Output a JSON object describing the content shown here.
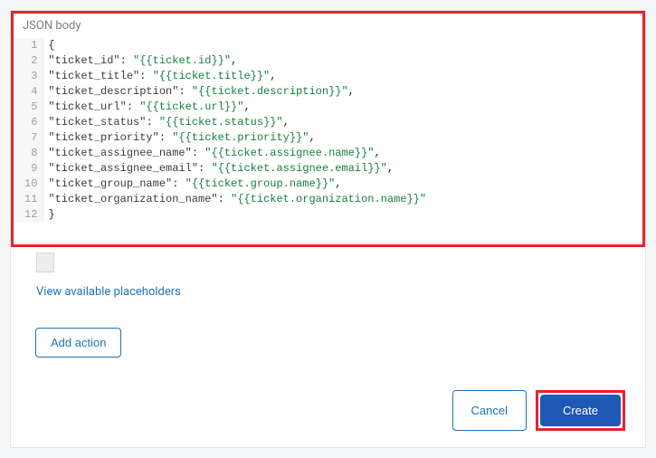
{
  "section": {
    "label": "JSON body"
  },
  "links": {
    "placeholders": "View available placeholders"
  },
  "actions": {
    "add": "Add action",
    "cancel": "Cancel",
    "create": "Create"
  },
  "code": {
    "lines": [
      "{",
      "\"ticket_id\": \"{{ticket.id}}\",",
      "\"ticket_title\": \"{{ticket.title}}\",",
      "\"ticket_description\": \"{{ticket.description}}\",",
      "\"ticket_url\": \"{{ticket.url}}\",",
      "\"ticket_status\": \"{{ticket.status}}\",",
      "\"ticket_priority\": \"{{ticket.priority}}\",",
      "\"ticket_assignee_name\": \"{{ticket.assignee.name}}\",",
      "\"ticket_assignee_email\": \"{{ticket.assignee.email}}\",",
      "\"ticket_group_name\": \"{{ticket.group.name}}\",",
      "\"ticket_organization_name\": \"{{ticket.organization.name}}\"",
      "}"
    ]
  }
}
